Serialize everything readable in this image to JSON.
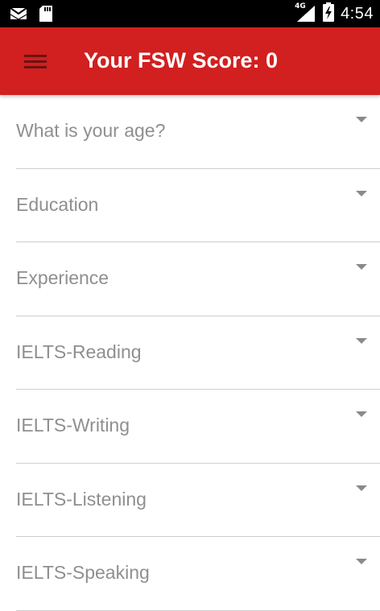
{
  "status_bar": {
    "time": "4:54",
    "network_type": "4G",
    "icons": [
      "mail-icon",
      "sd-card-icon",
      "signal-icon",
      "battery-charging-icon"
    ]
  },
  "app_bar": {
    "title": "Your FSW Score: 0",
    "menu_icon": "hamburger-menu-icon",
    "background_color": "#d21f1f"
  },
  "form": {
    "fields": [
      {
        "label": "What is your age?"
      },
      {
        "label": "Education"
      },
      {
        "label": "Experience"
      },
      {
        "label": "IELTS-Reading"
      },
      {
        "label": "IELTS-Writing"
      },
      {
        "label": "IELTS-Listening"
      },
      {
        "label": "IELTS-Speaking"
      }
    ]
  }
}
